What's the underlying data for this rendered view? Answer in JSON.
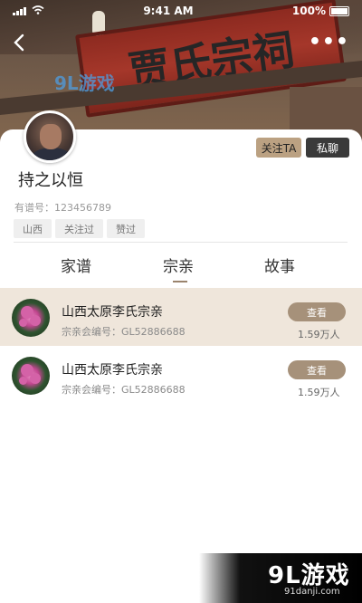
{
  "status_bar": {
    "time": "9:41 AM",
    "battery": "100%"
  },
  "header": {
    "back_icon": "chevron-left-icon",
    "more_icon": "more-dots-icon",
    "plaque_text": "贾氏宗祠",
    "watermark": "9L游戏"
  },
  "profile": {
    "follow_button": "关注TA",
    "chat_button": "私聊",
    "username": "持之以恒",
    "genealogy_label": "有谱号：",
    "genealogy_number": "123456789",
    "tags": [
      "山西",
      "关注过",
      "赞过"
    ]
  },
  "tabs": [
    "家谱",
    "宗亲",
    "故事"
  ],
  "active_tab": "宗亲",
  "clan_list": [
    {
      "title": "山西太原李氏宗亲",
      "code_label": "宗亲会编号：",
      "code": "GL52886688",
      "view_label": "查看",
      "members": "1.59万人",
      "highlighted": true
    },
    {
      "title": "山西太原李氏宗亲",
      "code_label": "宗亲会编号：",
      "code": "GL52886688",
      "view_label": "查看",
      "members": "1.59万人",
      "highlighted": false
    }
  ],
  "watermark_bottom": {
    "logo": "9L游戏",
    "url": "91danji.com"
  },
  "colors": {
    "accent": "#bba182",
    "dark_button": "#3a3a3a",
    "highlight_row": "#efe6db",
    "view_button": "#a6917a"
  }
}
